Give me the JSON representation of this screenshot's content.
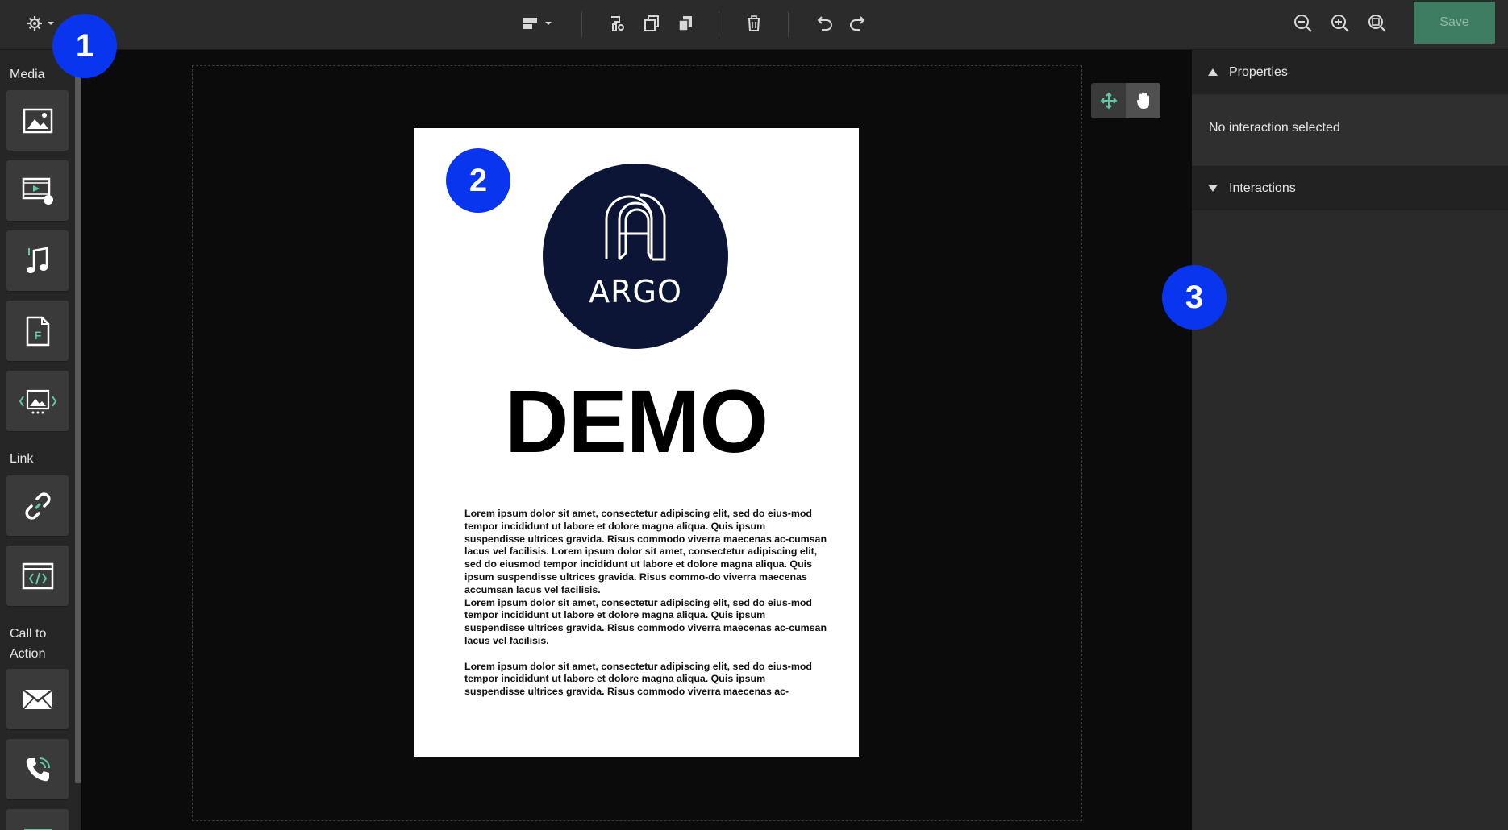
{
  "toolbar": {
    "save_label": "Save",
    "colors": {
      "bar": "#2b2b2b",
      "save_bg": "#3f7d62",
      "accent": "#5fc9a0"
    }
  },
  "sidebar": {
    "sections": [
      {
        "label": "Media",
        "tools": [
          "image-icon",
          "video-icon",
          "audio-icon",
          "file-icon",
          "gallery-icon"
        ]
      },
      {
        "label": "Link",
        "tools": [
          "link-icon",
          "embed-code-icon"
        ]
      },
      {
        "label": "Call to Action",
        "tools": [
          "email-icon",
          "phone-icon"
        ]
      }
    ]
  },
  "page": {
    "logo_text": "ARGO",
    "title": "DEMO",
    "paragraphs": [
      "Lorem ipsum dolor sit amet, consectetur adipiscing elit, sed do eius-mod tempor incididunt ut labore et dolore magna aliqua. Quis ipsum suspendisse ultrices gravida. Risus commodo viverra maecenas ac-cumsan lacus vel facilisis. Lorem ipsum dolor sit amet, consectetur adipiscing elit, sed do eiusmod tempor incididunt ut labore et dolore magna aliqua. Quis ipsum suspendisse ultrices gravida. Risus commo-do viverra maecenas accumsan lacus vel facilisis.",
      "Lorem ipsum dolor sit amet, consectetur adipiscing elit, sed do eius-mod tempor incididunt ut labore et dolore magna aliqua. Quis ipsum suspendisse ultrices gravida. Risus commodo viverra maecenas ac-cumsan lacus vel facilisis.",
      "Lorem ipsum dolor sit amet, consectetur adipiscing elit, sed do eius-mod tempor incididunt ut labore et dolore magna aliqua. Quis ipsum suspendisse ultrices gravida. Risus commodo viverra maecenas ac-"
    ]
  },
  "right_panel": {
    "properties_label": "Properties",
    "empty_message": "No interaction selected",
    "interactions_label": "Interactions"
  },
  "markers": [
    "1",
    "2",
    "3"
  ]
}
